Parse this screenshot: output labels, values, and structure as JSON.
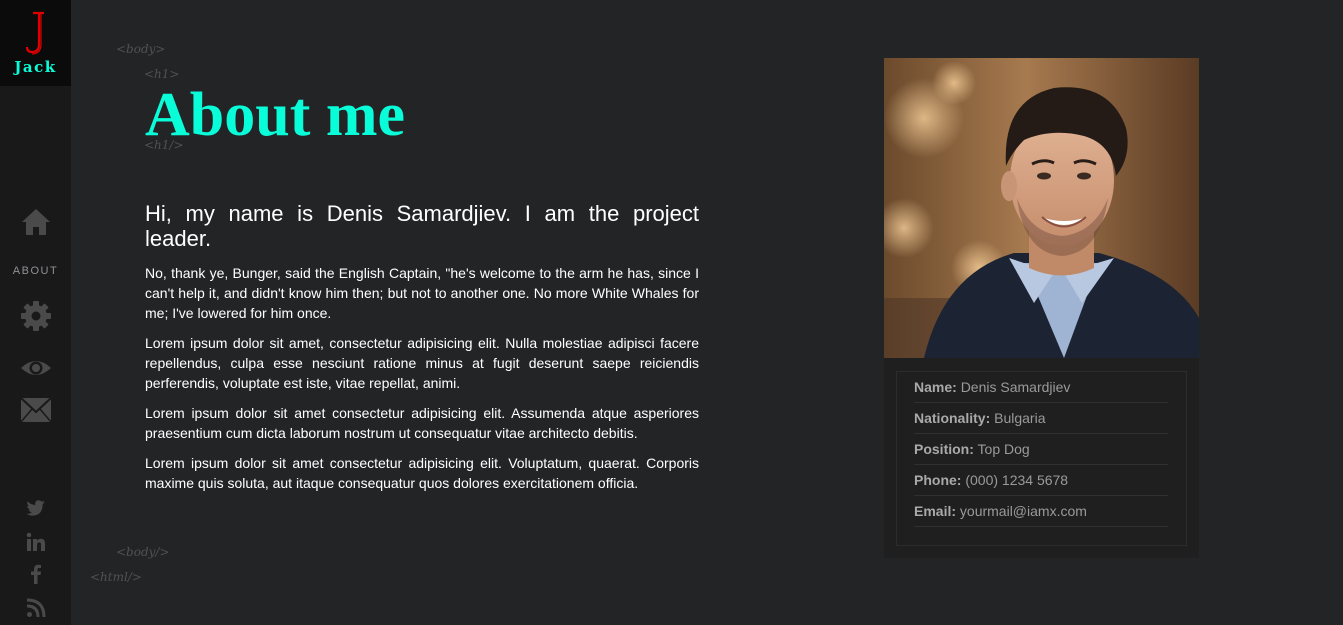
{
  "brand": {
    "logo_letter": "J",
    "logo_text": "Jack",
    "logo_color": "#e00000",
    "accent": "#08fdd8"
  },
  "nav": {
    "home_icon": "home-icon",
    "active_label": "ABOUT",
    "items": [
      "gear-icon",
      "eye-icon",
      "envelope-icon"
    ]
  },
  "social": [
    "twitter-icon",
    "linkedin-icon",
    "facebook-icon",
    "rss-icon"
  ],
  "tags": {
    "body_open": "<body>",
    "h1_open": "<h1>",
    "h1_close": "<h1/>",
    "body_close": "<body/>",
    "html_close": "<html/>"
  },
  "page": {
    "title": "About me",
    "lead": "Hi, my name is Denis Samardjiev. I am the project leader.",
    "paragraphs": [
      "No, thank ye, Bunger, said the English Captain, \"he's welcome to the arm he has, since I can't help it, and didn't know him then; but not to another one. No more White Whales for me; I've lowered for him once.",
      "Lorem ipsum dolor sit amet, consectetur adipisicing elit. Nulla molestiae adipisci facere repellendus, culpa esse nesciunt ratione minus at fugit deserunt saepe reiciendis perferendis, voluptate est iste, vitae repellat, animi.",
      "Lorem ipsum dolor sit amet consectetur adipisicing elit. Assumenda atque asperiores praesentium cum dicta laborum nostrum ut consequatur vitae architecto debitis.",
      "Lorem ipsum dolor sit amet consectetur adipisicing elit. Voluptatum, quaerat. Corporis maxime quis soluta, aut itaque consequatur quos dolores exercitationem officia."
    ]
  },
  "profile": {
    "info": [
      {
        "label": "Name:",
        "value": "Denis Samardjiev"
      },
      {
        "label": "Nationality:",
        "value": "Bulgaria"
      },
      {
        "label": "Position:",
        "value": "Top Dog"
      },
      {
        "label": "Phone:",
        "value": "(000) 1234 5678"
      },
      {
        "label": "Email:",
        "value": "yourmail@iamx.com"
      }
    ]
  }
}
